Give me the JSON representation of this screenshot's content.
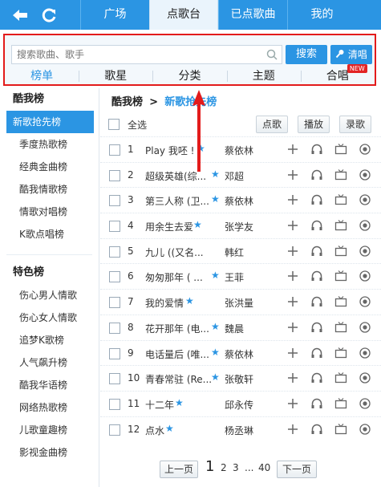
{
  "colors": {
    "accent": "#2b95e3",
    "highlight": "#e31b1b",
    "badge": "#e32424"
  },
  "topbar": {
    "back_icon": "back-arrow-icon",
    "refresh_icon": "refresh-icon",
    "tabs": [
      "广场",
      "点歌台",
      "已点歌曲",
      "我的"
    ],
    "active_tab": "点歌台"
  },
  "search": {
    "placeholder": "搜索歌曲、歌手",
    "search_button": "搜索",
    "clear_button": "清唱",
    "categories": [
      "榜单",
      "歌星",
      "分类",
      "主题",
      "合唱"
    ],
    "active_category": "榜单",
    "new_badge": "NEW"
  },
  "sidebar": {
    "section1_title": "酷我榜",
    "section1_items": [
      "新歌抢先榜",
      "季度热歌榜",
      "经典金曲榜",
      "酷我情歌榜",
      "情歌对唱榜",
      "K歌点唱榜"
    ],
    "active_item": "新歌抢先榜",
    "section2_title": "特色榜",
    "section2_items": [
      "伤心男人情歌",
      "伤心女人情歌",
      "追梦K歌榜",
      "人气飙升榜",
      "酷我华语榜",
      "网络热歌榜",
      "儿歌童趣榜",
      "影视金曲榜"
    ]
  },
  "main": {
    "breadcrumb_root": "酷我榜",
    "breadcrumb_sep": ">",
    "breadcrumb_current": "新歌抢先榜",
    "select_all": "全选",
    "btn_order": "点歌",
    "btn_play": "播放",
    "btn_record": "录歌"
  },
  "songs": [
    {
      "num": "1",
      "title": "Play 我呸 !",
      "artist": "蔡依林"
    },
    {
      "num": "2",
      "title": "超级英雄(综...",
      "artist": "邓超"
    },
    {
      "num": "3",
      "title": "第三人称 (卫...",
      "artist": "蔡依林"
    },
    {
      "num": "4",
      "title": "用余生去爱",
      "artist": "张学友"
    },
    {
      "num": "5",
      "title": "九儿 ((又名...",
      "artist": "韩红"
    },
    {
      "num": "6",
      "title": "匆匆那年 ( ...",
      "artist": "王菲"
    },
    {
      "num": "7",
      "title": "我的爱情",
      "artist": "张洪量"
    },
    {
      "num": "8",
      "title": "花开那年 (电...",
      "artist": "魏晨"
    },
    {
      "num": "9",
      "title": "电话量后 (唯...",
      "artist": "蔡依林"
    },
    {
      "num": "10",
      "title": "青春常驻 (Re...",
      "artist": "张敬轩"
    },
    {
      "num": "11",
      "title": "十二年",
      "artist": "邱永传"
    },
    {
      "num": "12",
      "title": "点水",
      "artist": "杨丞琳"
    }
  ],
  "pager": {
    "prev": "上一页",
    "current": "1",
    "pages": [
      "2",
      "3"
    ],
    "ellipsis": "...",
    "last": "40",
    "next": "下一页"
  }
}
